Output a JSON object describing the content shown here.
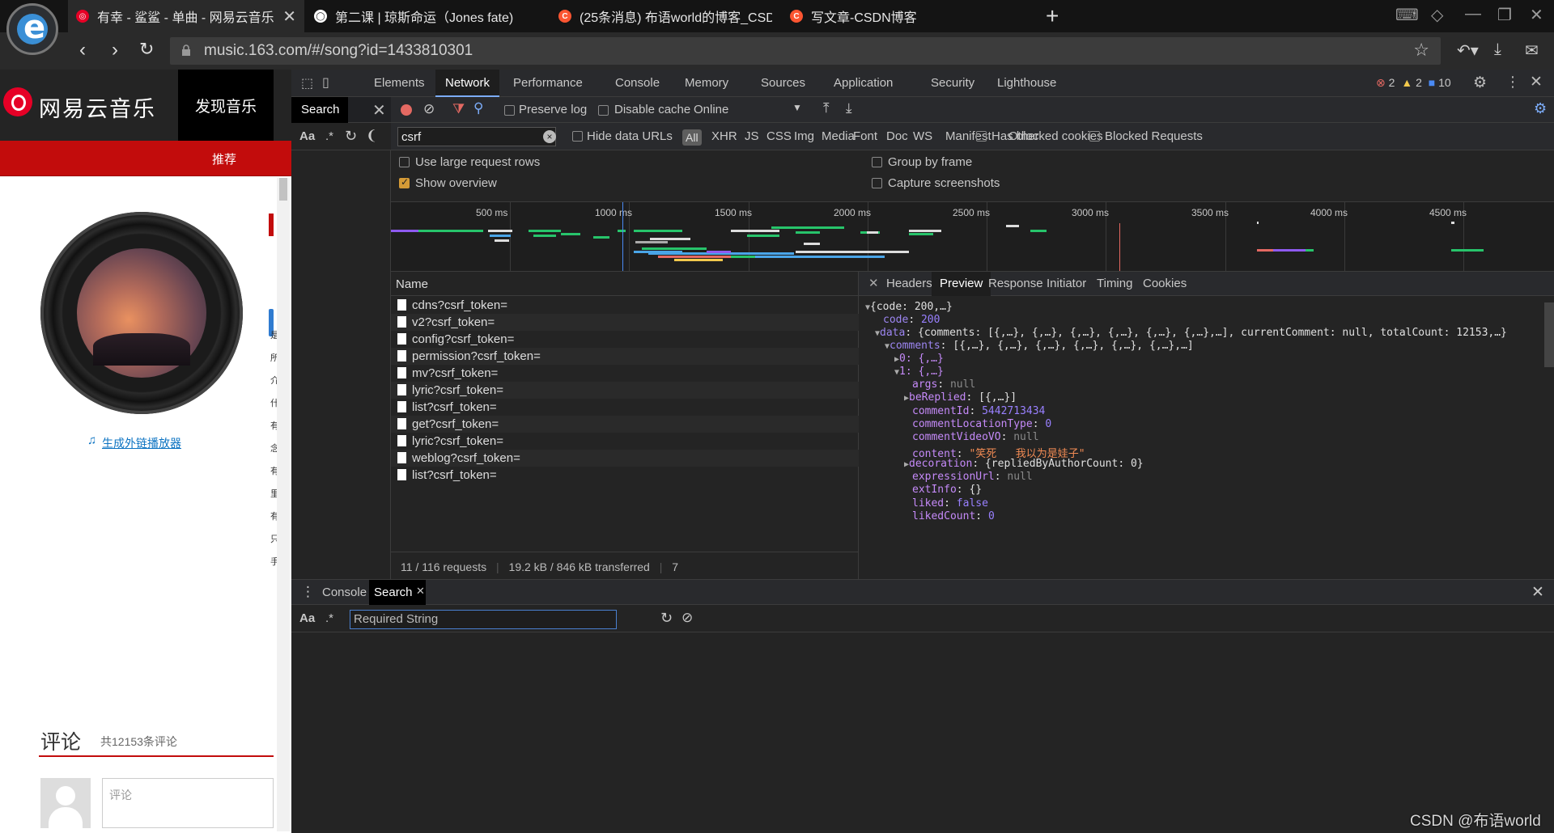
{
  "browser": {
    "tabs": [
      {
        "title": "有幸 - 鲨鲨 - 单曲 - 网易云音乐",
        "fav_color": "#e60026",
        "fav_glyph": "◎",
        "active": true
      },
      {
        "title": "第二课 | 琼斯命运（Jones fate)",
        "fav_color": "#ffffff",
        "fav_glyph": "◯",
        "active": false
      },
      {
        "title": "(25条消息) 布语world的博客_CSDN",
        "fav_color": "#fc5531",
        "fav_glyph": "C",
        "active": false
      },
      {
        "title": "写文章-CSDN博客",
        "fav_color": "#fc5531",
        "fav_glyph": "C",
        "active": false
      }
    ],
    "url": "music.163.com/#/song?id=1433810301"
  },
  "page": {
    "site_name": "网易云音乐",
    "nav_discover": "发现音乐",
    "sub_nav": "推荐",
    "gen_link": "生成外链播放器",
    "side_chars": [
      "是",
      "所",
      "介",
      "什",
      "有",
      "念",
      "有",
      "里",
      "有",
      "只",
      "手"
    ],
    "comment_title": "评论",
    "comment_count": "共12153条评论",
    "comment_placeholder": "评论"
  },
  "devtools": {
    "panels": [
      "Elements",
      "Network",
      "Performance",
      "Console",
      "Memory",
      "Sources",
      "Application",
      "Security",
      "Lighthouse"
    ],
    "active_panel": "Network",
    "issues": {
      "errors": "2",
      "warnings": "2",
      "info": "10"
    },
    "search_tab": "Search",
    "search_opts": {
      "case": "Aa",
      "regex": ".*"
    },
    "toolbar": {
      "preserve_log": "Preserve log",
      "disable_cache": "Disable cache",
      "throttle": "Online"
    },
    "filter": {
      "value": "csrf",
      "hide_data_urls": "Hide data URLs",
      "all": "All",
      "types": [
        "XHR",
        "JS",
        "CSS",
        "Img",
        "Media",
        "Font",
        "Doc",
        "WS",
        "Manifest",
        "Other"
      ],
      "blocked_cookies": "Has blocked cookies",
      "blocked_requests": "Blocked Requests"
    },
    "settings": {
      "large_rows": "Use large request rows",
      "show_overview": "Show overview",
      "group_by_frame": "Group by frame",
      "capture_screenshots": "Capture screenshots"
    },
    "overview_ticks": [
      "500 ms",
      "1000 ms",
      "1500 ms",
      "2000 ms",
      "2500 ms",
      "3000 ms",
      "3500 ms",
      "4000 ms",
      "4500 ms"
    ],
    "name_header": "Name",
    "requests": [
      "cdns?csrf_token=",
      "v2?csrf_token=",
      "config?csrf_token=",
      "permission?csrf_token=",
      "mv?csrf_token=",
      "lyric?csrf_token=",
      "list?csrf_token=",
      "get?csrf_token=",
      "lyric?csrf_token=",
      "weblog?csrf_token=",
      "list?csrf_token="
    ],
    "status_requests": "11 / 116 requests",
    "status_transfer": "19.2 kB / 846 kB transferred",
    "status_more": "7",
    "detail_tabs": [
      "Headers",
      "Preview",
      "Response",
      "Initiator",
      "Timing",
      "Cookies"
    ],
    "active_detail": "Preview",
    "preview": {
      "root": "{code: 200,…}",
      "code_key": "code",
      "code_val": "200",
      "data_key": "data",
      "data_summary": "{comments: [{,…}, {,…}, {,…}, {,…}, {,…}, {,…},…], currentComment: null, totalCount: 12153,…}",
      "comments_key": "comments",
      "comments_summary": "[{,…}, {,…}, {,…}, {,…}, {,…}, {,…},…]",
      "item0": "0: {,…}",
      "item1": "1: {,…}",
      "fields": [
        {
          "key": "args",
          "val": "null",
          "type": "null"
        },
        {
          "key": "beReplied",
          "val": "[{,…}]",
          "type": "obj",
          "expandable": true
        },
        {
          "key": "commentId",
          "val": "5442713434",
          "type": "num"
        },
        {
          "key": "commentLocationType",
          "val": "0",
          "type": "num"
        },
        {
          "key": "commentVideoVO",
          "val": "null",
          "type": "null"
        },
        {
          "key": "content",
          "val": "\"笑死   我以为是娃子\"",
          "type": "str"
        },
        {
          "key": "decoration",
          "val": "{repliedByAuthorCount: 0}",
          "type": "obj",
          "expandable": true
        },
        {
          "key": "expressionUrl",
          "val": "null",
          "type": "null"
        },
        {
          "key": "extInfo",
          "val": "{}",
          "type": "obj"
        },
        {
          "key": "liked",
          "val": "false",
          "type": "num"
        },
        {
          "key": "likedCount",
          "val": "0",
          "type": "num"
        }
      ]
    },
    "drawer": {
      "console": "Console",
      "search": "Search",
      "placeholder": "Required String"
    }
  },
  "watermark": "CSDN @布语world"
}
